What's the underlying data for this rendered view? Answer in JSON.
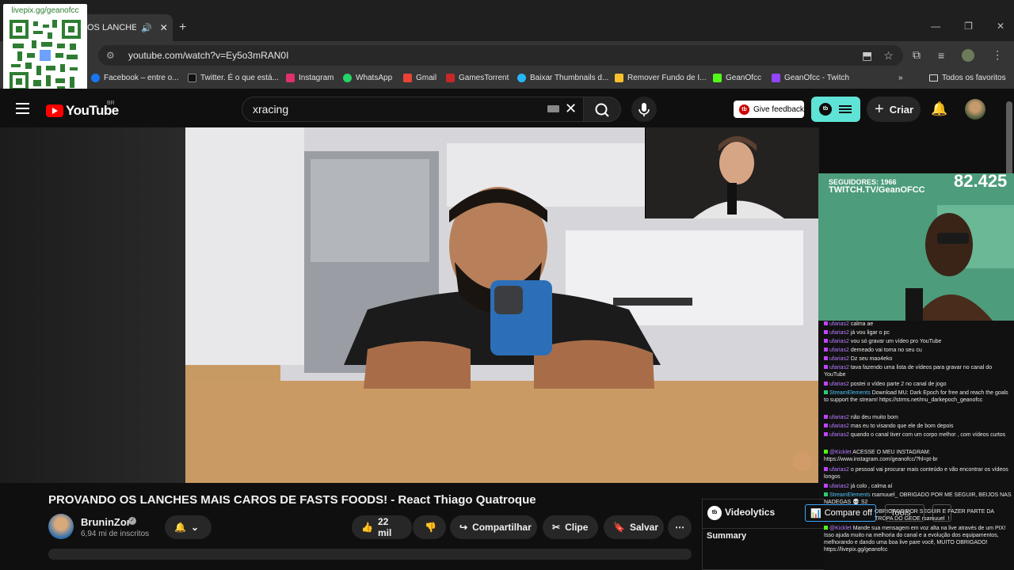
{
  "qr": {
    "label": "livepix.gg/geanofcc"
  },
  "browser": {
    "tab_title": "OS LANCHES M",
    "new_tab": "+",
    "url": "youtube.com/watch?v=Ey5o3mRAN0I",
    "bookmarks": [
      {
        "label": "Facebook – entre o...",
        "color": "#1877f2"
      },
      {
        "label": "Twitter. É o que está...",
        "color": "#111111"
      },
      {
        "label": "Instagram",
        "color": "#e1306c"
      },
      {
        "label": "WhatsApp",
        "color": "#25d366"
      },
      {
        "label": "Gmail",
        "color": "#ea4335"
      },
      {
        "label": "GamesTorrent",
        "color": "#c62828"
      },
      {
        "label": "Baixar Thumbnails d...",
        "color": "#29b6f6"
      },
      {
        "label": "Remover Fundo de I...",
        "color": "#fbc02d"
      },
      {
        "label": "GeanOfcc",
        "color": "#53fc18"
      },
      {
        "label": "GeanOfcc - Twitch",
        "color": "#9146ff"
      }
    ],
    "all_bookmarks": "Todos os favoritos"
  },
  "youtube": {
    "logo": "YouTube",
    "region": "BR",
    "search_value": "xracing",
    "feedback": "Give feedback",
    "create": "Criar"
  },
  "stream_overlay": {
    "followers_label": "SEGUIDORES: 1966",
    "channel": "TWITCH.TV/GeanOFCC",
    "count": "82.425"
  },
  "chat": [
    {
      "user": "ufarias2",
      "text": "calma ae"
    },
    {
      "user": "ufarias2",
      "text": "já vou ligar o pc"
    },
    {
      "user": "ufarias2",
      "text": "vou só gravar um vídeo pro YouTube"
    },
    {
      "user": "ufarias2",
      "text": "demeado vai toma no seu cu"
    },
    {
      "user": "ufarias2",
      "text": "Dz seu mao4eko"
    },
    {
      "user": "ufarias2",
      "text": "tava fazendo uma lista de vídeos para gravar no canal do YouTube"
    },
    {
      "user": "ufarias2",
      "text": "postei o vídeo parte 2 no canal de jogo"
    },
    {
      "user": "StreamElements",
      "text": "Download MU: Dark Epoch for free and reach the goals to support the stream! https://strms.net/mu_darkepoch_geanofcc"
    },
    {
      "user": "ufarias2",
      "text": "não deu muito bom"
    },
    {
      "user": "ufarias2",
      "text": "mas eu to visando que ele de bom depois"
    },
    {
      "user": "ufarias2",
      "text": "quando o canal tiver com um corpo melhor , com vídeos curtos"
    },
    {
      "user": "@Kicklet",
      "text": "ACESSE O MEU INSTAGRAM: https://www.instagram.com/geanofcc/?hl=pt-br"
    },
    {
      "user": "ufarias2",
      "text": "o pessoal vai procurar mais conteúdo e vão encontrar os vídeos longos"
    },
    {
      "user": "ufarias2",
      "text": "já colo , calma aí"
    },
    {
      "user": "StreamElements",
      "text": "rsamuuel_ OBRIGADO POR ME SEGUIR, BEIJOS NAS NADEGAS 💀 S2"
    },
    {
      "user": "",
      "text": "OBRIGADO POR SEGUIR E FAZER PARTE DA TROPA DO GEOE rsamuuel_!"
    },
    {
      "user": "@Kicklet",
      "text": "Mande sua mensagem em voz alta na live através de um PIX! Isso ajuda muito na melhoria do canal e a evolução dos equipamentos, melhorando e dando uma boa live pare você, MUITO OBRIGADO! https://livepix.gg/geanofcc"
    }
  ],
  "video": {
    "title": "PROVANDO OS LANCHES MAIS CAROS DE FASTS FOODS! - React Thiago Quatroque",
    "channel": "BruninZor",
    "subscribers": "6,94 mi de inscritos",
    "likes": "22 mil",
    "share": "Compartilhar",
    "clip": "Clipe",
    "save": "Salvar"
  },
  "videolytics": {
    "title": "Videolytics",
    "summary": "Summary",
    "compare": "Compare",
    "compare_state": "off",
    "tools": "Tools"
  }
}
